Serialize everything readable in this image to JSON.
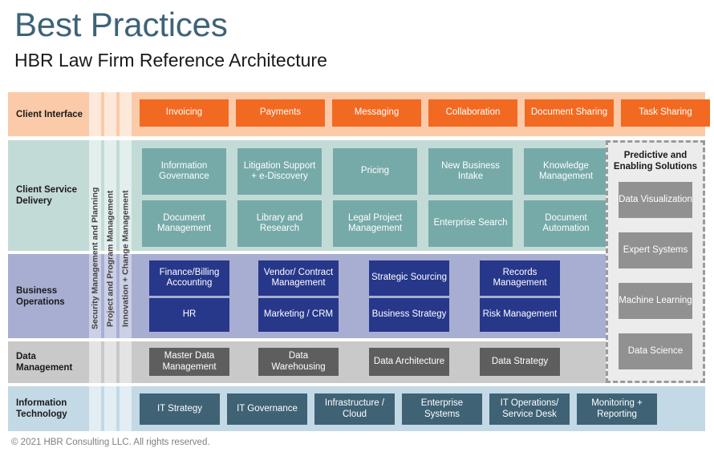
{
  "header": {
    "title": "Best Practices",
    "subtitle": "HBR Law Firm Reference Architecture"
  },
  "colors": {
    "title_blue": "#3d6377",
    "client_interface_band": "#fbcaa8",
    "client_interface_box": "#f26a21",
    "client_service_band": "#c3dbd7",
    "client_service_box": "#76aaa8",
    "business_ops_band": "#a8aed2",
    "business_ops_box": "#27378a",
    "data_mgmt_band": "#c9c9c9",
    "data_mgmt_box": "#5e5e5e",
    "info_tech_band": "#c3d9e5",
    "info_tech_box": "#3f6275",
    "predictive_panel": "#ececec",
    "predictive_box": "#919191",
    "footer_gray": "#808080"
  },
  "vertical_columns": [
    {
      "label": "Security Management and Planning"
    },
    {
      "label": "Project and Program Management"
    },
    {
      "label": "Innovation + Change Management"
    }
  ],
  "rows": {
    "client_interface": {
      "label": "Client Interface",
      "boxes": [
        "Invoicing",
        "Payments",
        "Messaging",
        "Collaboration",
        "Document Sharing",
        "Task Sharing"
      ]
    },
    "client_service_delivery": {
      "label": "Client Service Delivery",
      "row1": [
        "Information Governance",
        "Litigation Support + e-Discovery",
        "Pricing",
        "New Business Intake",
        "Knowledge Management"
      ],
      "row2": [
        "Document Management",
        "Library and Research",
        "Legal Project Management",
        "Enterprise Search",
        "Document Automation"
      ]
    },
    "business_operations": {
      "label": "Business Operations",
      "row1": [
        "Finance/Billing Accounting",
        "Vendor/ Contract Management",
        "Strategic Sourcing",
        "Records Management"
      ],
      "row2": [
        "HR",
        "Marketing / CRM",
        "Business Strategy",
        "Risk Management"
      ]
    },
    "data_management": {
      "label": "Data Management",
      "boxes": [
        "Master Data Management",
        "Data Warehousing",
        "Data Architecture",
        "Data Strategy"
      ]
    },
    "information_technology": {
      "label": "Information Technology",
      "boxes": [
        "IT Strategy",
        "IT Governance",
        "Infrastructure / Cloud",
        "Enterprise Systems",
        "IT Operations/ Service Desk",
        "Monitoring + Reporting"
      ]
    }
  },
  "predictive_panel": {
    "title": "Predictive and Enabling Solutions",
    "boxes": [
      "Data Visualization",
      "Expert Systems",
      "Machine Learning",
      "Data Science"
    ]
  },
  "footer": {
    "copyright": "© 2021 HBR Consulting LLC. All rights reserved."
  }
}
